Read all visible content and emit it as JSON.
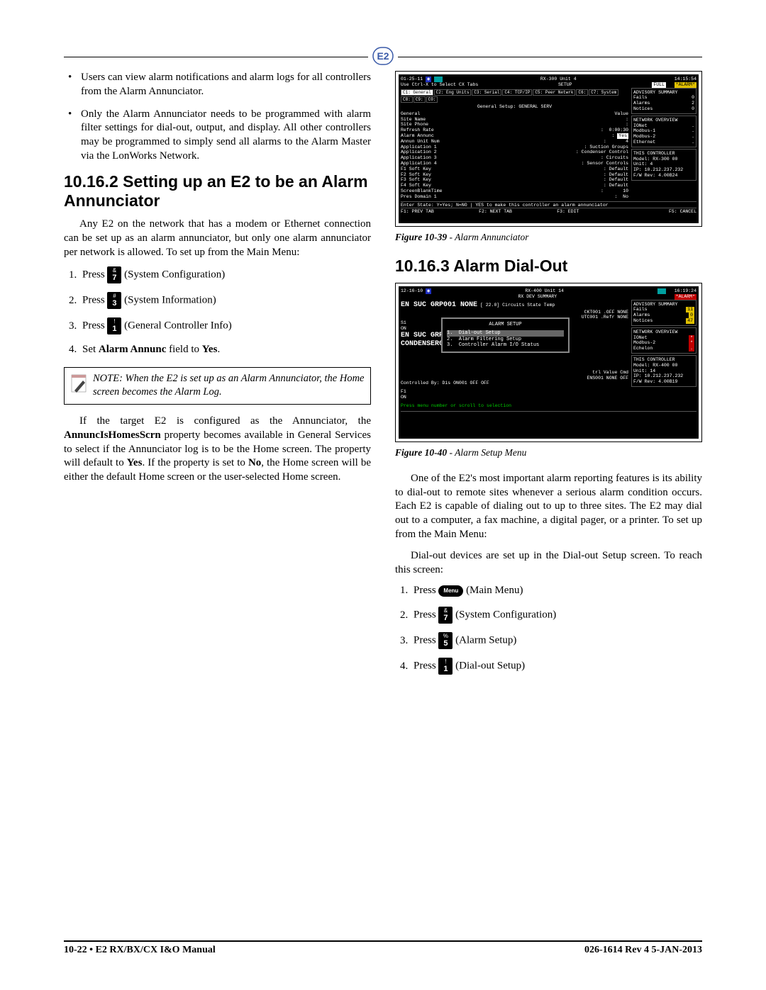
{
  "header_logo_label": "E2",
  "left": {
    "bullets": [
      "Users can view alarm notifications and alarm logs for all controllers from the Alarm Annunciator.",
      "Only the Alarm Annunciator needs to be programmed with alarm filter settings for dial-out, output, and display. All other controllers may be programmed to simply send all alarms to the Alarm Master via the LonWorks Network."
    ],
    "h_10_16_2": "10.16.2  Setting up an E2 to be an Alarm Annunciator",
    "p_intro": "Any E2 on the network that has a modem or Ethernet connection can be set up as an alarm annunciator, but only one alarm annunciator per network is allowed. To set up from the Main Menu:",
    "steps": [
      {
        "pre": "Press",
        "key": {
          "sym": "&",
          "num": "7"
        },
        "post": "(System Configuration)"
      },
      {
        "pre": "Press",
        "key": {
          "sym": "#",
          "num": "3"
        },
        "post": "(System Information)"
      },
      {
        "pre": "Press",
        "key": {
          "sym": "!",
          "num": "1"
        },
        "post": "(General Controller Info)"
      },
      {
        "plain_pre": "Set",
        "plain_bold": "Alarm Annunc",
        "plain_mid": " field to ",
        "plain_bold2": "Yes",
        "plain_post": "."
      }
    ],
    "note": "NOTE: When the E2 is set up as an Alarm Annunciator, the Home screen becomes the Alarm Log.",
    "p_after_a": "If the target E2 is configured as the Annunciator, the ",
    "p_after_b": "AnnuncIsHomesScrn",
    "p_after_c": " property becomes available in General Services to select if the Annunciator log is to be the Home screen.  The property will default to ",
    "p_after_d": "Yes",
    "p_after_e": ". If the property is set to ",
    "p_after_f": "No",
    "p_after_g": ", the Home screen will be either the default Home screen or the user-selected Home screen."
  },
  "right": {
    "fig39": {
      "caption_bold": "Figure 10-39",
      "caption_rest": " - Alarm Annunciator"
    },
    "h_10_16_3": "10.16.3  Alarm Dial-Out",
    "fig40": {
      "caption_bold": "Figure 10-40",
      "caption_rest": " - Alarm Setup Menu"
    },
    "p_dial_intro": "One of the E2's most important alarm reporting features is its ability to dial-out to remote sites whenever a serious alarm condition occurs. Each E2 is capable of dialing out to up to three sites. The E2 may dial out to a computer, a fax machine, a digital pager, or a printer. To set up from the Main Menu:",
    "p_dial2": "Dial-out devices are set up in the Dial-out Setup screen. To reach this screen:",
    "steps": [
      {
        "pre": "Press",
        "menu": true,
        "menu_label": "Menu",
        "post": "(Main Menu)"
      },
      {
        "pre": "Press",
        "key": {
          "sym": "&",
          "num": "7"
        },
        "post": "(System Configuration)"
      },
      {
        "pre": "Press",
        "key": {
          "sym": "%",
          "num": "5"
        },
        "post": "(Alarm Setup)"
      },
      {
        "pre": "Press",
        "key": {
          "sym": "!",
          "num": "1"
        },
        "post": "(Dial-out Setup)"
      }
    ]
  },
  "term39": {
    "top_left": "01-25-11 ",
    "top_mid": "RX-300 Unit 4",
    "top_right": "14:15:54",
    "top2_l": "Use Ctrl-X to Select CX Tabs",
    "top2_m": "SETUP",
    "top2_badge1": "FULL",
    "top2_badge2": "*ALARM*",
    "tabs": [
      "C1: General",
      "C2: Eng Units",
      "C3: Serial",
      "C4: TCP/IP",
      "C5: Peer Netwrk",
      "C6:",
      "C7: System",
      "C8:",
      "C9:",
      "C0:"
    ],
    "section_title": "General Setup: GENERAL SERV",
    "kv_header": {
      "c1": "General",
      "c2": "Value"
    },
    "kv": [
      {
        "k": "Site Name",
        "v": ":"
      },
      {
        "k": "Site Phone",
        "v": ":"
      },
      {
        "k": "Refresh Rate",
        "v": ":  0:00:30"
      },
      {
        "k": "Alarm Annunc",
        "v": ": Yes",
        "hl": true
      },
      {
        "k": "Annun Unit Num",
        "v": ":       4"
      },
      {
        "k": "Application 1",
        "v": ": Suction Groups"
      },
      {
        "k": "Application 2",
        "v": ": Condenser Control"
      },
      {
        "k": "Application 3",
        "v": ": Circuits"
      },
      {
        "k": "Application 4",
        "v": ": Sensor Controls"
      },
      {
        "k": "F1 Soft Key",
        "v": ": Default"
      },
      {
        "k": "F2 Soft Key",
        "v": ": Default"
      },
      {
        "k": "F3 Soft Key",
        "v": ": Default"
      },
      {
        "k": "F4 Soft Key",
        "v": ": Default"
      },
      {
        "k": "ScreenBlankTime",
        "v": ":       10"
      },
      {
        "k": "Pres Domain 1",
        "v": ":  No"
      }
    ],
    "side_adv": {
      "title": "ADVISORY SUMMARY",
      "rows": [
        [
          "Fails",
          "0"
        ],
        [
          "Alarms",
          "2"
        ],
        [
          "Notices",
          "0"
        ]
      ]
    },
    "side_net": {
      "title": "NETWORK OVERVIEW",
      "rows": [
        [
          "IONet",
          "."
        ],
        [
          "Modbus-1",
          "."
        ],
        [
          "Modbus-2",
          "."
        ],
        [
          "Ethernet",
          "."
        ]
      ]
    },
    "side_ctrl": {
      "title": "THIS CONTROLLER",
      "rows": [
        "Model: RX-300   00",
        "Unit: 4",
        "IP: 10.212.237.232",
        "F/W Rev: 4.00B24"
      ]
    },
    "status": "Enter State:  Y=Yes;  N=NO  |  YES to make this controller an alarm annunciator",
    "fkeys": [
      "F1: PREV TAB",
      "F2: NEXT TAB",
      "F3: EDIT",
      "",
      "F5: CANCEL"
    ]
  },
  "term40": {
    "top_left": "12-16-10 ",
    "top_mid": "RX-400 Unit 14",
    "top_right": "16:19:24",
    "top2_m": "RX DEV SUMMARY",
    "top2_badge2": "*ALARM*",
    "suc_line": "EN  SUC  GRP001   NONE",
    "suc_val": "[ 22.0]",
    "labels": [
      "Circuits",
      "State Temp",
      "CKT001 .OFF  NONE",
      "UTC001 .Refr NONE"
    ],
    "left_groups": [
      "S1",
      "ON",
      "",
      "EN SUC GRP002    NO",
      "",
      "CONDENSER0"
    ],
    "menu_title": "ALARM SETUP",
    "menu_items": [
      "1.  Dial-out Setup",
      "2.  Alarm Filtering Setup",
      "3.  Controller Alarm I/O Status"
    ],
    "menu_sel": 0,
    "ctrl_line1": "trl   Value  Cmd",
    "ctrl_line2": "ENS001 NONE   OFF",
    "ctrl_line3": "Controlled By: Dis         ON001  OFF   OFF",
    "f1on": "F1\nON",
    "side_adv": {
      "title": "ADVISORY SUMMARY",
      "rows": [
        [
          "Fails",
          "11"
        ],
        [
          "Alarms",
          "0"
        ],
        [
          "Notices",
          "47"
        ]
      ]
    },
    "side_net": {
      "title": "NETWORK OVERVIEW",
      "rows": [
        [
          "IONet",
          "*"
        ],
        [
          "Modbus-2",
          "*"
        ],
        [
          "Echelon",
          "."
        ]
      ]
    },
    "side_ctrl": {
      "title": "THIS CONTROLLER",
      "rows": [
        "Model: RX-400   00",
        "Unit: 14",
        "IP: 10.212.237.232",
        "F/W Rev: 4.00B19"
      ]
    },
    "status": "Press menu number or scroll to selection"
  },
  "footer": {
    "left": "10-22 • E2 RX/BX/CX I&O Manual",
    "right": "026-1614 Rev 4 5-JAN-2013"
  }
}
